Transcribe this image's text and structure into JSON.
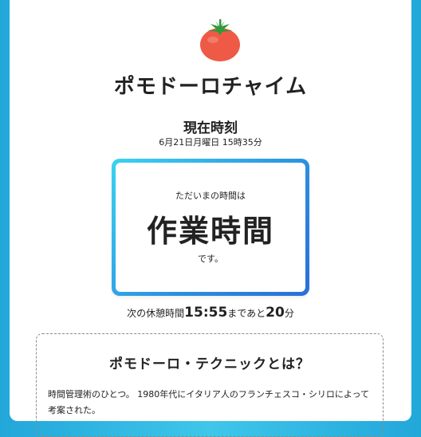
{
  "app": {
    "title": "ポモドーロチャイム",
    "logo_icon": "tomato-icon"
  },
  "now": {
    "heading": "現在時刻",
    "datetime": "6月21日月曜日 15時35分"
  },
  "status": {
    "prefix": "ただいまの時間は",
    "main": "作業時間",
    "suffix": "です。"
  },
  "next_break": {
    "label": "次の休憩時間",
    "time": "15:55",
    "connector": "まであと",
    "minutes": "20",
    "unit": "分"
  },
  "info": {
    "title": "ポモドーロ・テクニックとは？",
    "body": "時間管理術のひとつ。 1980年代にイタリア人のフランチェスコ・シリロによって考案された。"
  },
  "colors": {
    "background": "#2ab4e0",
    "accent_gradient_start": "#3ad3f2",
    "accent_gradient_end": "#2a6ed8",
    "tomato": "#ee5a45",
    "leaf": "#2e9b3a"
  }
}
